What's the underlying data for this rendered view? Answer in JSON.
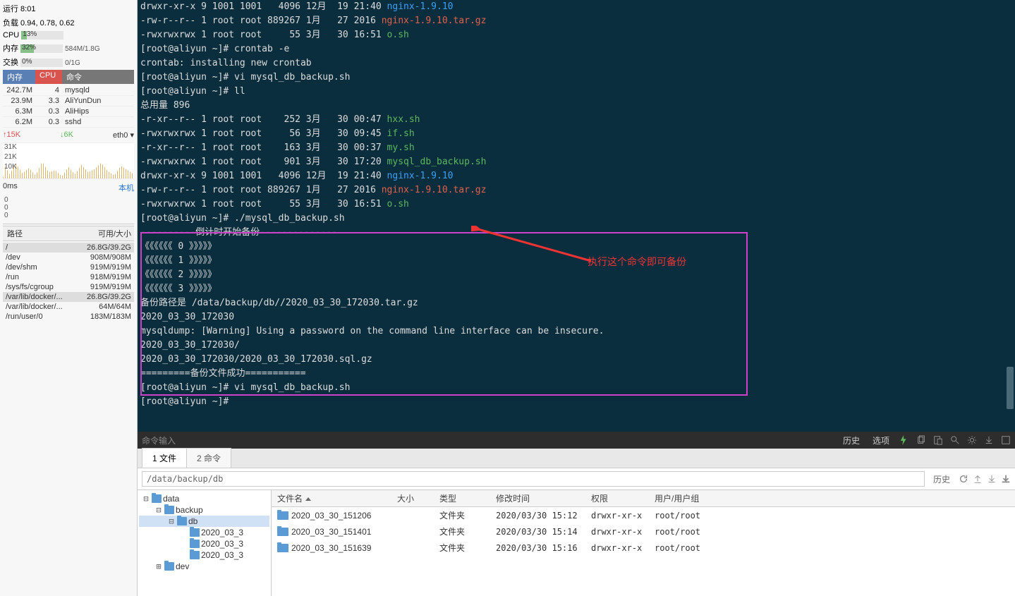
{
  "side": {
    "uptime": "运行 8:01",
    "load": "负载 0.94, 0.78, 0.62",
    "cpu_label": "CPU",
    "cpu_pct": "13%",
    "mem_label": "内存",
    "mem_pct": "32%",
    "mem_txt": "584M/1.8G",
    "swap_label": "交换",
    "swap_pct": "0%",
    "swap_txt": "0/1G",
    "hdr": {
      "mem": "内存",
      "cpu": "CPU",
      "cmd": "命令"
    },
    "procs": [
      {
        "mem": "242.7M",
        "cpu": "4",
        "cmd": "mysqld"
      },
      {
        "mem": "23.9M",
        "cpu": "3.3",
        "cmd": "AliYunDun"
      },
      {
        "mem": "6.3M",
        "cpu": "0.3",
        "cmd": "AliHips"
      },
      {
        "mem": "6.2M",
        "cpu": "0.3",
        "cmd": "sshd"
      }
    ],
    "net": {
      "up": "↑15K",
      "down": "↓6K",
      "iface": "eth0 ▾"
    },
    "axis": [
      "31K",
      "21K",
      "10K"
    ],
    "lat": {
      "ms": "0ms",
      "host": "本机"
    },
    "lat_axis": [
      "0",
      "0",
      "0"
    ],
    "disk_hdr": {
      "path": "路径",
      "avail": "可用/大小"
    },
    "disks": [
      {
        "p": "/",
        "v": "26.8G/39.2G",
        "hl": true
      },
      {
        "p": "/dev",
        "v": "908M/908M"
      },
      {
        "p": "/dev/shm",
        "v": "919M/919M"
      },
      {
        "p": "/run",
        "v": "918M/919M"
      },
      {
        "p": "/sys/fs/cgroup",
        "v": "919M/919M"
      },
      {
        "p": "/var/lib/docker/...",
        "v": "26.8G/39.2G",
        "hl": true
      },
      {
        "p": "/var/lib/docker/...",
        "v": "64M/64M"
      },
      {
        "p": "/run/user/0",
        "v": "183M/183M"
      }
    ]
  },
  "term": {
    "lines": [
      {
        "seg": [
          {
            "t": "drwxr-xr-x 9 1001 1001   4096 12月  19 21:40 ",
            "c": "wt"
          },
          {
            "t": "nginx-1.9.10",
            "c": "bl"
          }
        ]
      },
      {
        "seg": [
          {
            "t": "-rw-r--r-- 1 root root 889267 1月   27 2016 ",
            "c": "wt"
          },
          {
            "t": "nginx-1.9.10.tar.gz",
            "c": "rd"
          }
        ]
      },
      {
        "seg": [
          {
            "t": "-rwxrwxrwx 1 root root     55 3月   30 16:51 ",
            "c": "wt"
          },
          {
            "t": "o.sh",
            "c": "g"
          }
        ]
      },
      {
        "seg": [
          {
            "t": "[root@aliyun ~]# crontab -e",
            "c": "wt"
          }
        ]
      },
      {
        "seg": [
          {
            "t": "crontab: installing new crontab",
            "c": "wt"
          }
        ]
      },
      {
        "seg": [
          {
            "t": "[root@aliyun ~]# vi mysql_db_backup.sh",
            "c": "wt"
          }
        ]
      },
      {
        "seg": [
          {
            "t": "[root@aliyun ~]# ll",
            "c": "wt"
          }
        ]
      },
      {
        "seg": [
          {
            "t": "总用量 896",
            "c": "wt"
          }
        ]
      },
      {
        "seg": [
          {
            "t": "-r-xr--r-- 1 root root    252 3月   30 00:47 ",
            "c": "wt"
          },
          {
            "t": "hxx.sh",
            "c": "g"
          }
        ]
      },
      {
        "seg": [
          {
            "t": "-rwxrwxrwx 1 root root     56 3月   30 09:45 ",
            "c": "wt"
          },
          {
            "t": "if.sh",
            "c": "g"
          }
        ]
      },
      {
        "seg": [
          {
            "t": "-r-xr--r-- 1 root root    163 3月   30 00:37 ",
            "c": "wt"
          },
          {
            "t": "my.sh",
            "c": "g"
          }
        ]
      },
      {
        "seg": [
          {
            "t": "-rwxrwxrwx 1 root root    901 3月   30 17:20 ",
            "c": "wt"
          },
          {
            "t": "mysql_db_backup.sh",
            "c": "g"
          }
        ]
      },
      {
        "seg": [
          {
            "t": "drwxr-xr-x 9 1001 1001   4096 12月  19 21:40 ",
            "c": "wt"
          },
          {
            "t": "nginx-1.9.10",
            "c": "bl"
          }
        ]
      },
      {
        "seg": [
          {
            "t": "-rw-r--r-- 1 root root 889267 1月   27 2016 ",
            "c": "wt"
          },
          {
            "t": "nginx-1.9.10.tar.gz",
            "c": "rd"
          }
        ]
      },
      {
        "seg": [
          {
            "t": "-rwxrwxrwx 1 root root     55 3月   30 16:51 ",
            "c": "wt"
          },
          {
            "t": "o.sh",
            "c": "g"
          }
        ]
      },
      {
        "seg": [
          {
            "t": "[root@aliyun ~]# ./mysql_db_backup.sh",
            "c": "wt"
          }
        ]
      },
      {
        "seg": [
          {
            "t": "----------倒计时开始备份--------------",
            "c": "wt"
          }
        ]
      },
      {
        "seg": [
          {
            "t": "《《《《《《 0 》》》》》",
            "c": "wt"
          }
        ]
      },
      {
        "seg": [
          {
            "t": "《《《《《《 1 》》》》》",
            "c": "wt"
          }
        ]
      },
      {
        "seg": [
          {
            "t": "《《《《《《 2 》》》》》",
            "c": "wt"
          }
        ]
      },
      {
        "seg": [
          {
            "t": "《《《《《《 3 》》》》》",
            "c": "wt"
          }
        ]
      },
      {
        "seg": [
          {
            "t": "备份路径是 /data/backup/db//2020_03_30_172030.tar.gz",
            "c": "wt"
          }
        ]
      },
      {
        "seg": [
          {
            "t": "2020_03_30_172030",
            "c": "wt"
          }
        ]
      },
      {
        "seg": [
          {
            "t": "mysqldump: [Warning] Using a password on the command line interface can be insecure.",
            "c": "wt"
          }
        ]
      },
      {
        "seg": [
          {
            "t": "2020_03_30_172030/",
            "c": "wt"
          }
        ]
      },
      {
        "seg": [
          {
            "t": "2020_03_30_172030/2020_03_30_172030.sql.gz",
            "c": "wt"
          }
        ]
      },
      {
        "seg": [
          {
            "t": "=========备份文件成功===========",
            "c": "wt"
          }
        ]
      },
      {
        "seg": [
          {
            "t": "[root@aliyun ~]# vi mysql_db_backup.sh",
            "c": "wt"
          }
        ]
      },
      {
        "seg": [
          {
            "t": "[root@aliyun ~]# ",
            "c": "wt"
          }
        ]
      }
    ],
    "annotation": "执行这个命令即可备份"
  },
  "cmdbar": {
    "placeholder": "命令输入",
    "history": "历史",
    "opts": "选项"
  },
  "tabs": [
    {
      "l": "1 文件",
      "a": true
    },
    {
      "l": "2 命令",
      "a": false
    }
  ],
  "fbar": {
    "path": "/data/backup/db",
    "history": "历史"
  },
  "tree": [
    {
      "d": 0,
      "t": "⊟",
      "n": "data"
    },
    {
      "d": 1,
      "t": "⊟",
      "n": "backup"
    },
    {
      "d": 2,
      "t": "⊟",
      "n": "db",
      "sel": true
    },
    {
      "d": 3,
      "t": "",
      "n": "2020_03_3"
    },
    {
      "d": 3,
      "t": "",
      "n": "2020_03_3"
    },
    {
      "d": 3,
      "t": "",
      "n": "2020_03_3"
    },
    {
      "d": 1,
      "t": "⊞",
      "n": "dev"
    }
  ],
  "flist": {
    "hdr": {
      "name": "文件名",
      "size": "大小",
      "type": "类型",
      "mod": "修改时间",
      "perm": "权限",
      "own": "用户/用户组"
    },
    "rows": [
      {
        "name": "2020_03_30_151206",
        "size": "",
        "type": "文件夹",
        "mod": "2020/03/30 15:12",
        "perm": "drwxr-xr-x",
        "own": "root/root"
      },
      {
        "name": "2020_03_30_151401",
        "size": "",
        "type": "文件夹",
        "mod": "2020/03/30 15:14",
        "perm": "drwxr-xr-x",
        "own": "root/root"
      },
      {
        "name": "2020_03_30_151639",
        "size": "",
        "type": "文件夹",
        "mod": "2020/03/30 15:16",
        "perm": "drwxr-xr-x",
        "own": "root/root"
      }
    ]
  }
}
